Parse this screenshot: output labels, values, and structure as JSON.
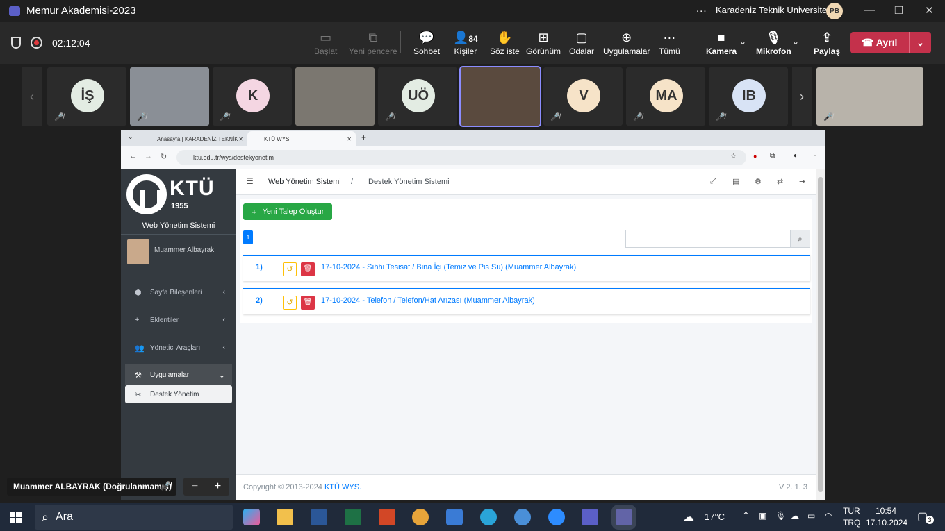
{
  "teams": {
    "title": "Memur Akademisi-2023",
    "org": "Karadeniz Teknik Üniversitesi",
    "avatar_initials": "PB",
    "more": "...",
    "recording_time": "02:12:04",
    "toolbar": {
      "start": "Başlat",
      "new_window": "Yeni pencere",
      "chat": "Sohbet",
      "people": "Kişiler",
      "people_count": "84",
      "raise_hand": "Söz iste",
      "view": "Görünüm",
      "rooms": "Odalar",
      "apps": "Uygulamalar",
      "more": "Tümü",
      "camera": "Kamera",
      "mic": "Mikrofon",
      "share": "Paylaş",
      "leave": "Ayrıl"
    },
    "participants": [
      {
        "initials": "İŞ",
        "color": "#e3ece3"
      },
      {
        "initials": "",
        "video": true
      },
      {
        "initials": "K",
        "color": "#f4d6e2"
      },
      {
        "initials": "",
        "video": true
      },
      {
        "initials": "UÖ",
        "color": "#e3ece3"
      },
      {
        "initials": "",
        "video": true,
        "active": true
      },
      {
        "initials": "V",
        "color": "#f6e3c8"
      },
      {
        "initials": "MA",
        "color": "#f6e3c8"
      },
      {
        "initials": "IB",
        "color": "#d8e3f5"
      },
      {
        "initials": "",
        "video": true
      }
    ],
    "name_tag": "Muammer ALBAYRAK (Doğrulanmamış)"
  },
  "browser": {
    "tab1": "Anasayfa | KARADENİZ TEKNİK",
    "tab2": "KTÜ WYS",
    "url": "ktu.edu.tr/wys/destekyonetim"
  },
  "wys": {
    "logo_text": "KTÜ",
    "logo_year": "1955",
    "system_title": "Web Yönetim Sistemi",
    "user_name": "Muammer Albayrak",
    "menu": [
      {
        "label": "Sayfa Bileşenleri",
        "icon": "cubes-icon"
      },
      {
        "label": "Eklentiler",
        "icon": "plus-icon"
      },
      {
        "label": "Yönetici Araçları",
        "icon": "users-cog-icon"
      },
      {
        "label": "Uygulamalar",
        "icon": "tools-icon"
      },
      {
        "label": "Destek Yönetim",
        "icon": "wrench-icon"
      }
    ],
    "breadcrumb_root": "Web Yönetim Sistemi",
    "breadcrumb_sep": "/",
    "breadcrumb_current": "Destek Yönetim Sistemi",
    "new_request": "Yeni Talep Oluştur",
    "page_number": "1",
    "tickets": [
      {
        "no": "1)",
        "text": "17-10-2024 - Sıhhi Tesisat / Bina İçi (Temiz ve Pis Su) (Muammer Albayrak)"
      },
      {
        "no": "2)",
        "text": "17-10-2024 - Telefon / Telefon/Hat Arızası (Muammer Albayrak)"
      }
    ],
    "copyright_prefix": "Copyright © 2013-2024",
    "copyright_brand": "KTÜ WYS.",
    "version": "V 2. 1. 3"
  },
  "taskbar": {
    "search": "Ara",
    "weather": "17°C",
    "lang1": "TUR",
    "lang2": "TRQ",
    "time": "10:54",
    "date": "17.10.2024",
    "notif_count": "3"
  }
}
